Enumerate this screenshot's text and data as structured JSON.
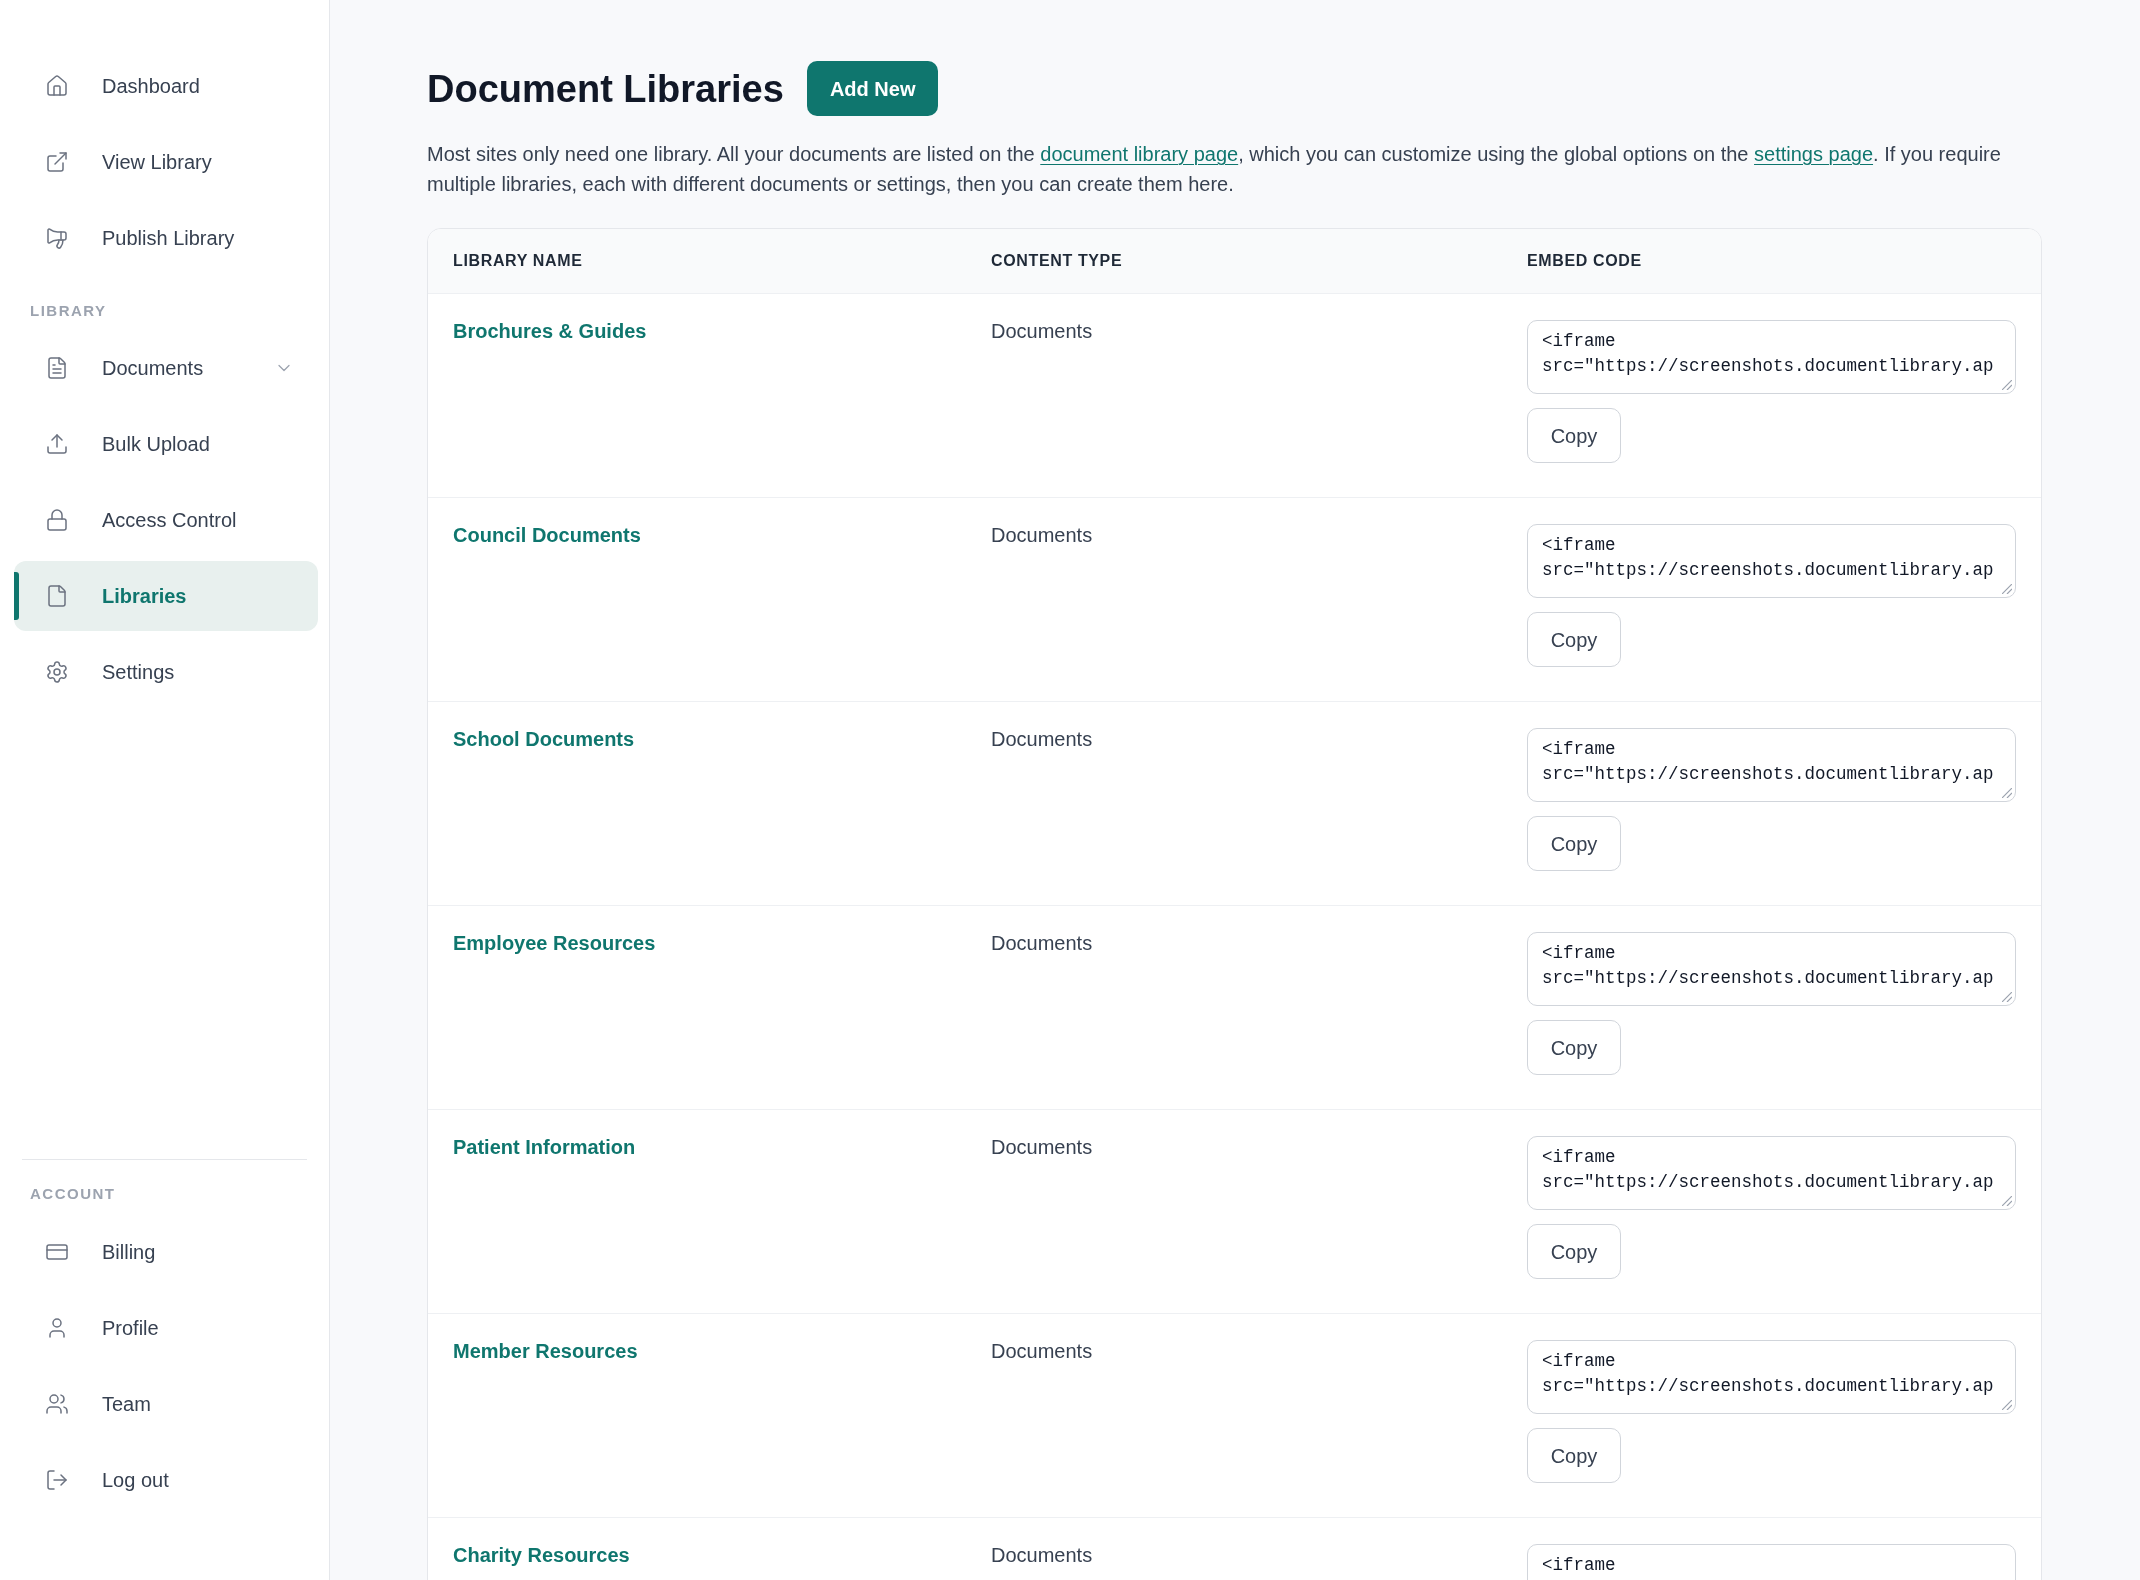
{
  "sidebar": {
    "sections": [
      {
        "items": [
          {
            "label": "Dashboard",
            "kind": "link",
            "selected": false
          },
          {
            "label": "View Library",
            "kind": "link",
            "selected": false
          },
          {
            "label": "Publish Library",
            "kind": "link",
            "selected": false
          }
        ]
      },
      {
        "title": "LIBRARY",
        "items": [
          {
            "label": "Documents",
            "kind": "group",
            "expanded": false,
            "selected": false
          },
          {
            "label": "Bulk Upload",
            "kind": "link",
            "selected": false
          },
          {
            "label": "Access Control",
            "kind": "link",
            "selected": false
          },
          {
            "label": "Libraries",
            "kind": "link",
            "selected": true
          },
          {
            "label": "Settings",
            "kind": "link",
            "selected": false
          }
        ]
      },
      {
        "title": "ACCOUNT",
        "items": [
          {
            "label": "Billing",
            "kind": "link",
            "selected": false
          },
          {
            "label": "Profile",
            "kind": "link",
            "selected": false
          },
          {
            "label": "Team",
            "kind": "link",
            "selected": false
          },
          {
            "label": "Log out",
            "kind": "link",
            "selected": false
          }
        ]
      }
    ]
  },
  "main": {
    "title": "Document Libraries",
    "add_button": "Add New",
    "intro": [
      {
        "kind": "text",
        "text": "Most sites only need one library. All your documents are listed on the "
      },
      {
        "kind": "link",
        "text": "document library page"
      },
      {
        "kind": "text",
        "text": ", which you can customize using the global options on the "
      },
      {
        "kind": "link",
        "text": "settings page"
      },
      {
        "kind": "text",
        "text": ". If you require multiple libraries, each with different documents or settings, then you can create them here."
      }
    ],
    "table": {
      "columns": [
        "LIBRARY NAME",
        "CONTENT TYPE",
        "EMBED CODE"
      ],
      "rows": [
        {
          "name": "Brochures & Guides",
          "content_type": "Documents",
          "embed_code": "<iframe src=\"https://screenshots.documentlibrary.ap",
          "copy_button": "Copy"
        },
        {
          "name": "Council Documents",
          "content_type": "Documents",
          "embed_code": "<iframe src=\"https://screenshots.documentlibrary.ap",
          "copy_button": "Copy"
        },
        {
          "name": "School Documents",
          "content_type": "Documents",
          "embed_code": "<iframe src=\"https://screenshots.documentlibrary.ap",
          "copy_button": "Copy"
        },
        {
          "name": "Employee Resources",
          "content_type": "Documents",
          "embed_code": "<iframe src=\"https://screenshots.documentlibrary.ap",
          "copy_button": "Copy"
        },
        {
          "name": "Patient Information",
          "content_type": "Documents",
          "embed_code": "<iframe src=\"https://screenshots.documentlibrary.ap",
          "copy_button": "Copy"
        },
        {
          "name": "Member Resources",
          "content_type": "Documents",
          "embed_code": "<iframe src=\"https://screenshots.documentlibrary.ap",
          "copy_button": "Copy"
        },
        {
          "name": "Charity Resources",
          "content_type": "Documents",
          "embed_code": "<iframe"
        }
      ]
    }
  }
}
